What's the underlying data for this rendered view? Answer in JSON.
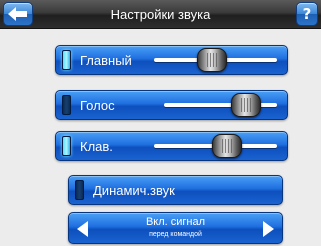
{
  "header": {
    "title": "Настройки звука",
    "back_icon": "arrow-left-icon",
    "help_label": "?"
  },
  "sliders": [
    {
      "label": "Главный",
      "led_on": true,
      "level": 0.47
    },
    {
      "label": "Голос",
      "led_on": false,
      "level": 0.73
    },
    {
      "label": "Клав.",
      "led_on": true,
      "level": 0.59
    }
  ],
  "toggle": {
    "label": "Динамич.звук",
    "led_on": false
  },
  "selector": {
    "value": "Вкл. сигнал",
    "subtitle": "перед командой"
  },
  "colors": {
    "button_blue": "#1f6fe0",
    "header_dark": "#2e2e2e",
    "background": "#ececec",
    "led_on": "#4fe0ff"
  }
}
